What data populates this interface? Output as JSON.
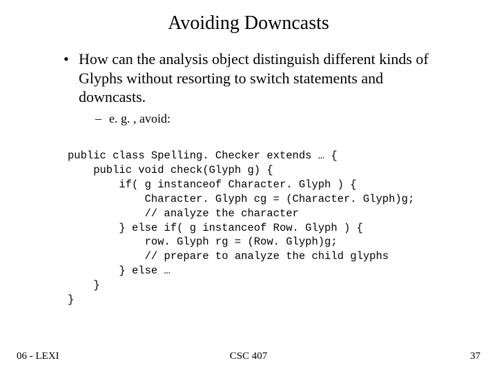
{
  "title": "Avoiding Downcasts",
  "bullet1": "How can the analysis object distinguish different kinds of Glyphs without resorting to switch statements and downcasts.",
  "bullet2": "e. g. , avoid:",
  "code_lines": {
    "l0": "public class Spelling. Checker extends … {",
    "l1": "    public void check(Glyph g) {",
    "l2": "        if( g instanceof Character. Glyph ) {",
    "l3": "            Character. Glyph cg = (Character. Glyph)g;",
    "l4": "            // analyze the character",
    "l5": "        } else if( g instanceof Row. Glyph ) {",
    "l6": "            row. Glyph rg = (Row. Glyph)g;",
    "l7": "            // prepare to analyze the child glyphs",
    "l8": "        } else …",
    "l9": "    }",
    "l10": "}"
  },
  "footer": {
    "left": "06 - LEXI",
    "center": "CSC 407",
    "right": "37"
  }
}
